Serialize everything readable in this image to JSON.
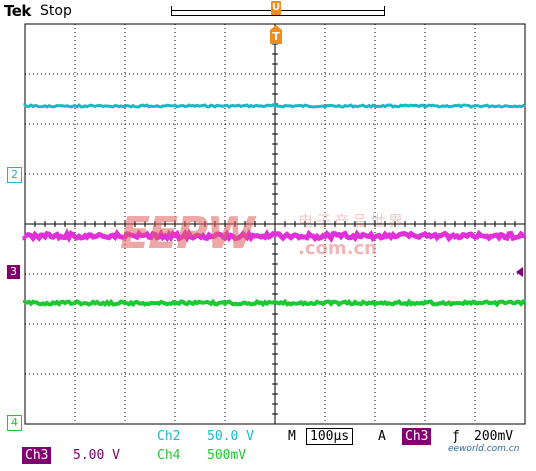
{
  "header": {
    "brand": "Tek",
    "run_state": "Stop",
    "trigger_position_glyph": "U",
    "trigger_marker_glyph": "T"
  },
  "channel_markers": {
    "ch2": "2",
    "ch3": "3",
    "ch4": "4"
  },
  "status": {
    "ch2_label": "Ch2",
    "ch2_scale": "50.0 V",
    "ch3_label": "Ch3",
    "ch3_scale": "5.00 V",
    "ch4_label": "Ch4",
    "ch4_scale": "500mV",
    "timebase_label": "M",
    "timebase_value": "100µs",
    "trigger_label": "A",
    "trigger_source": "Ch3",
    "trigger_slope": "ƒ",
    "trigger_level": "200mV"
  },
  "watermark": {
    "logo": "EEPW",
    "domain": ".com.cn",
    "cn": "电子产品世界"
  },
  "credit": "eeworld.com.cn",
  "colors": {
    "ch2": "#19b8c8",
    "ch3": "#e030d8",
    "ch4": "#1ec832",
    "trigger": "#f08c1e",
    "ch3_badge": "#800070"
  }
}
